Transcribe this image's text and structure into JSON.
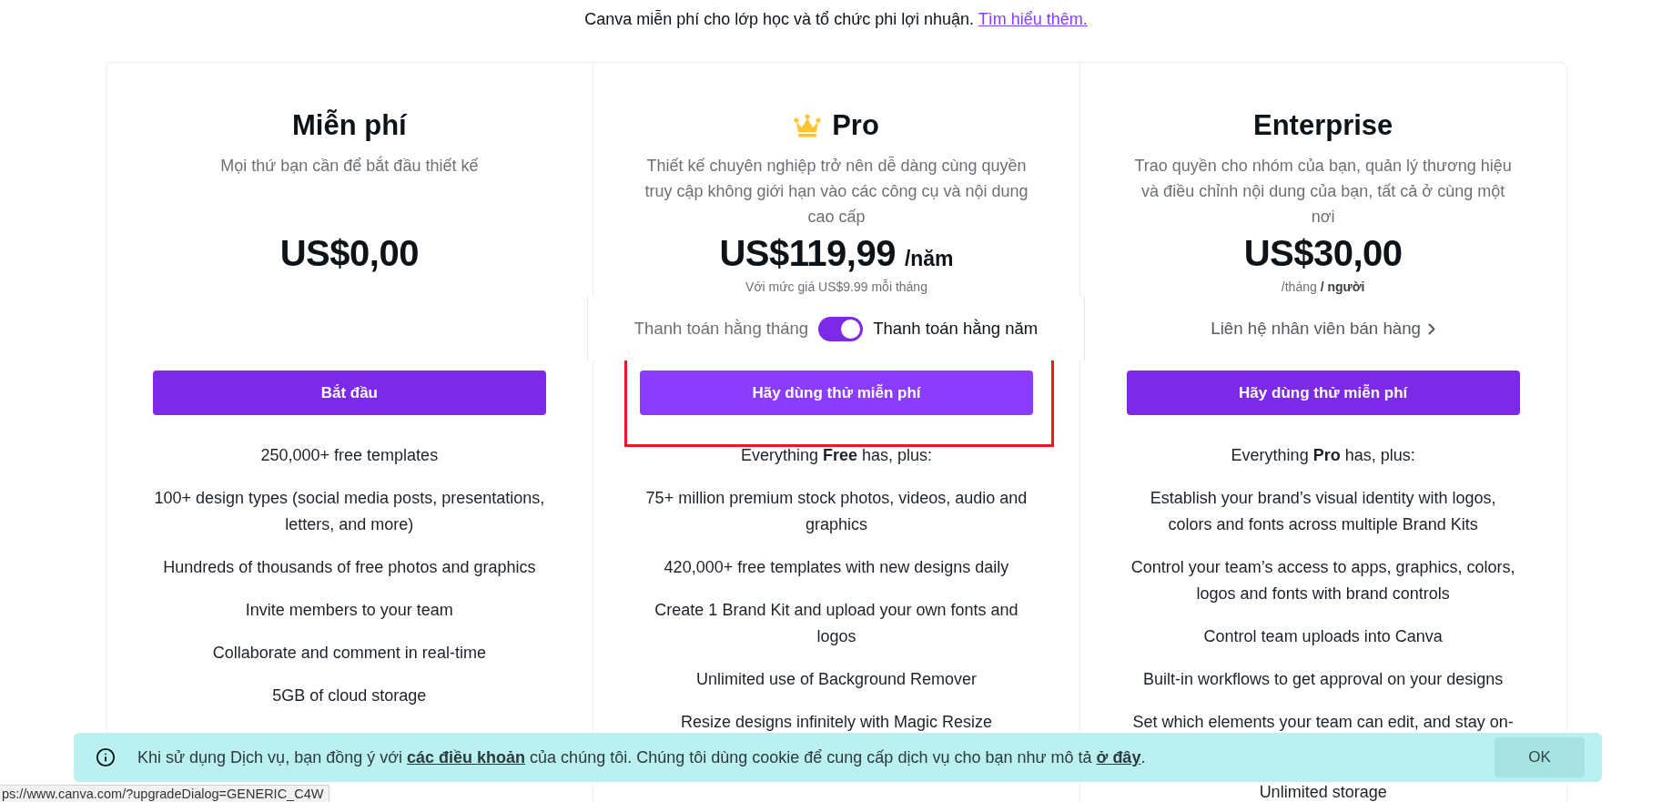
{
  "top_notice": {
    "text": "Canva miễn phí cho lớp học và tổ chức phi lợi nhuận.",
    "link": "Tìm hiểu thêm."
  },
  "plans": [
    {
      "name": "Miễn phí",
      "description": "Mọi thứ bạn cần để bắt đầu thiết kế",
      "price": "US$0,00",
      "cta": {
        "label": "Bắt đầu",
        "hovered": false
      },
      "features": [
        {
          "kind": "full",
          "text": "250,000+ free templates"
        },
        {
          "kind": "full",
          "text": "100+ design types (social media posts, presentations, letters, and more)"
        },
        {
          "kind": "full",
          "text": "Hundreds of thousands of free photos and graphics"
        },
        {
          "kind": "full",
          "text": "Invite members to your team"
        },
        {
          "kind": "full",
          "text": "Collaborate and comment in real-time"
        },
        {
          "kind": "full",
          "text": "5GB of cloud storage"
        }
      ]
    },
    {
      "name": "Pro",
      "crown": true,
      "description": "Thiết kế chuyên nghiệp trở nên dễ dàng cùng quyền truy cập không giới hạn vào các công cụ và nội dung cao cấp",
      "price": "US$119,99",
      "price_period": "/năm",
      "price_note": "Với mức giá US$9.99 mỗi tháng",
      "billing_toggle": {
        "monthly_label": "Thanh toán hằng tháng",
        "annual_label": "Thanh toán hằng năm",
        "annual": true
      },
      "cta": {
        "label": "Hãy dùng thử miễn phí",
        "hovered": true,
        "highlighted": true
      },
      "features": [
        {
          "kind": "full",
          "text": "Everything **Free** has, plus:"
        },
        {
          "kind": "full",
          "text": "75+ million premium stock photos, videos, audio and graphics"
        },
        {
          "kind": "full",
          "text": "420,000+ free templates with new designs daily"
        },
        {
          "kind": "full",
          "text": "Create 1 Brand Kit and upload your own fonts and logos"
        },
        {
          "kind": "full",
          "text": "Unlimited use of Background Remover"
        },
        {
          "kind": "full",
          "text": "Resize designs infinitely with Magic Resize"
        }
      ]
    },
    {
      "name": "Enterprise",
      "description": "Trao quyền cho nhóm của bạn, quản lý thương hiệu và điều chỉnh nội dung của bạn, tất cả ở cùng một nơi",
      "price": "US$30,00",
      "price_note": "/tháng **/ người**",
      "contact_link": "Liên hệ nhân viên bán hàng",
      "cta": {
        "label": "Hãy dùng thử miễn phí",
        "hovered": false
      },
      "features": [
        {
          "kind": "full",
          "text": "Everything **Pro** has, plus:"
        },
        {
          "kind": "full",
          "text": "Establish your brand’s visual identity with logos, colors and fonts across multiple Brand Kits"
        },
        {
          "kind": "full",
          "text": "Control your team’s access to apps, graphics, colors, logos and fonts with brand controls"
        },
        {
          "kind": "full",
          "text": "Control team uploads into Canva"
        },
        {
          "kind": "full",
          "text": "Built-in workflows to get approval on your designs"
        },
        {
          "kind": "cut",
          "text": "Set which elements your team can edit, and stay on-"
        },
        {
          "kind": "full",
          "text": "Unlimited storage"
        }
      ]
    }
  ],
  "cookie_notice": {
    "text_before": "Khi sử dụng Dịch vụ, bạn đồng ý với",
    "terms_link": "các điều khoản",
    "text_middle": "của chúng tôi. Chúng tôi dùng cookie để cung cấp dịch vụ cho bạn như mô tả",
    "details_link": "ở đây",
    "text_after": ".",
    "button": "OK"
  },
  "status_url": "ps://www.canva.com/?upgradeDialog=GENERIC_C4W"
}
